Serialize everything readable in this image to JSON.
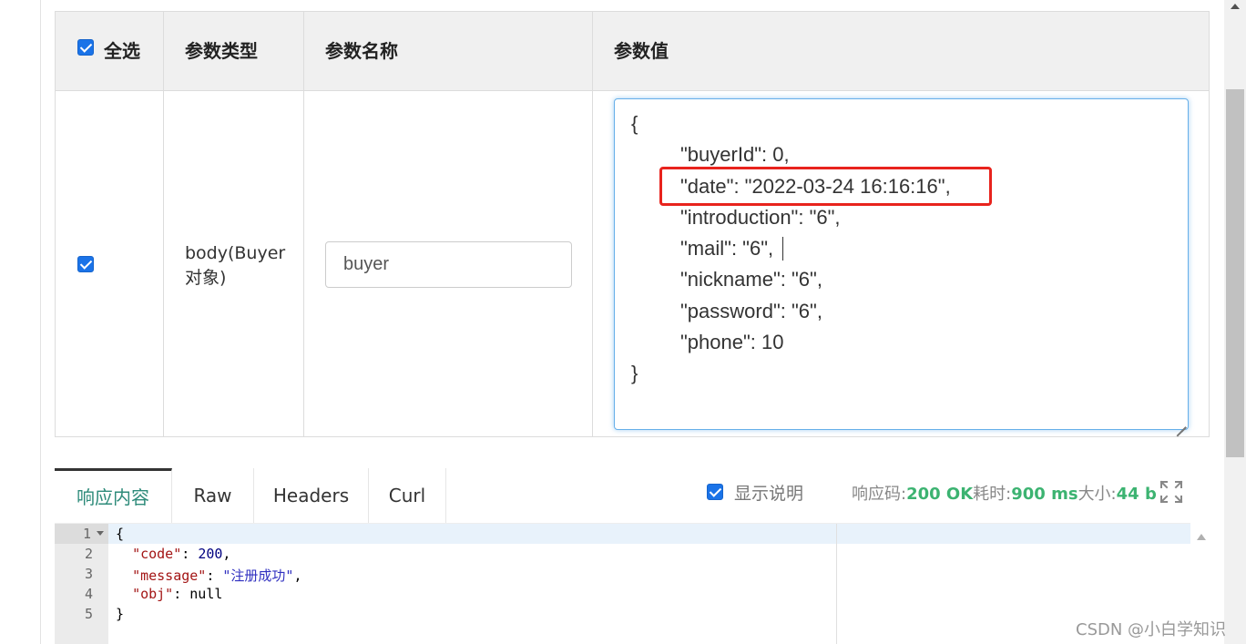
{
  "param_table": {
    "headers": {
      "select_all": "全选",
      "param_type": "参数类型",
      "param_name": "参数名称",
      "param_value": "参数值"
    },
    "row": {
      "checked": true,
      "type_line1": "body(Buyer",
      "type_line2": "对象)",
      "name_value": "buyer",
      "json_lines": [
        "{",
        "\"buyerId\": 0,",
        "\"date\": \"2022-03-24 16:16:16\",",
        "\"introduction\": \"6\",",
        "\"mail\": \"6\",",
        "\"nickname\": \"6\",",
        "\"password\": \"6\",",
        "\"phone\": 10",
        "}"
      ]
    }
  },
  "response": {
    "tabs": [
      "响应内容",
      "Raw",
      "Headers",
      "Curl"
    ],
    "active_tab": "响应内容",
    "show_desc_label": "显示说明",
    "show_desc_checked": true,
    "status_label": "响应码:",
    "status_value": "200 OK",
    "time_label": "耗时:",
    "time_value": "900 ms",
    "size_label": "大小:",
    "size_value": "44 b",
    "body_lines": [
      "1",
      "2",
      "3",
      "4",
      "5"
    ],
    "code": {
      "open": "{",
      "code_key": "\"code\"",
      "code_val": "200",
      "message_key": "\"message\"",
      "message_val": "\"注册成功\"",
      "obj_key": "\"obj\"",
      "obj_val": "null",
      "close": "}"
    }
  },
  "watermark": "CSDN @小白学知识",
  "colors": {
    "accent": "#1a73e8",
    "highlight": "#e8231d",
    "status_green": "#3cb371",
    "active_tab_text": "#2e8b7a"
  }
}
